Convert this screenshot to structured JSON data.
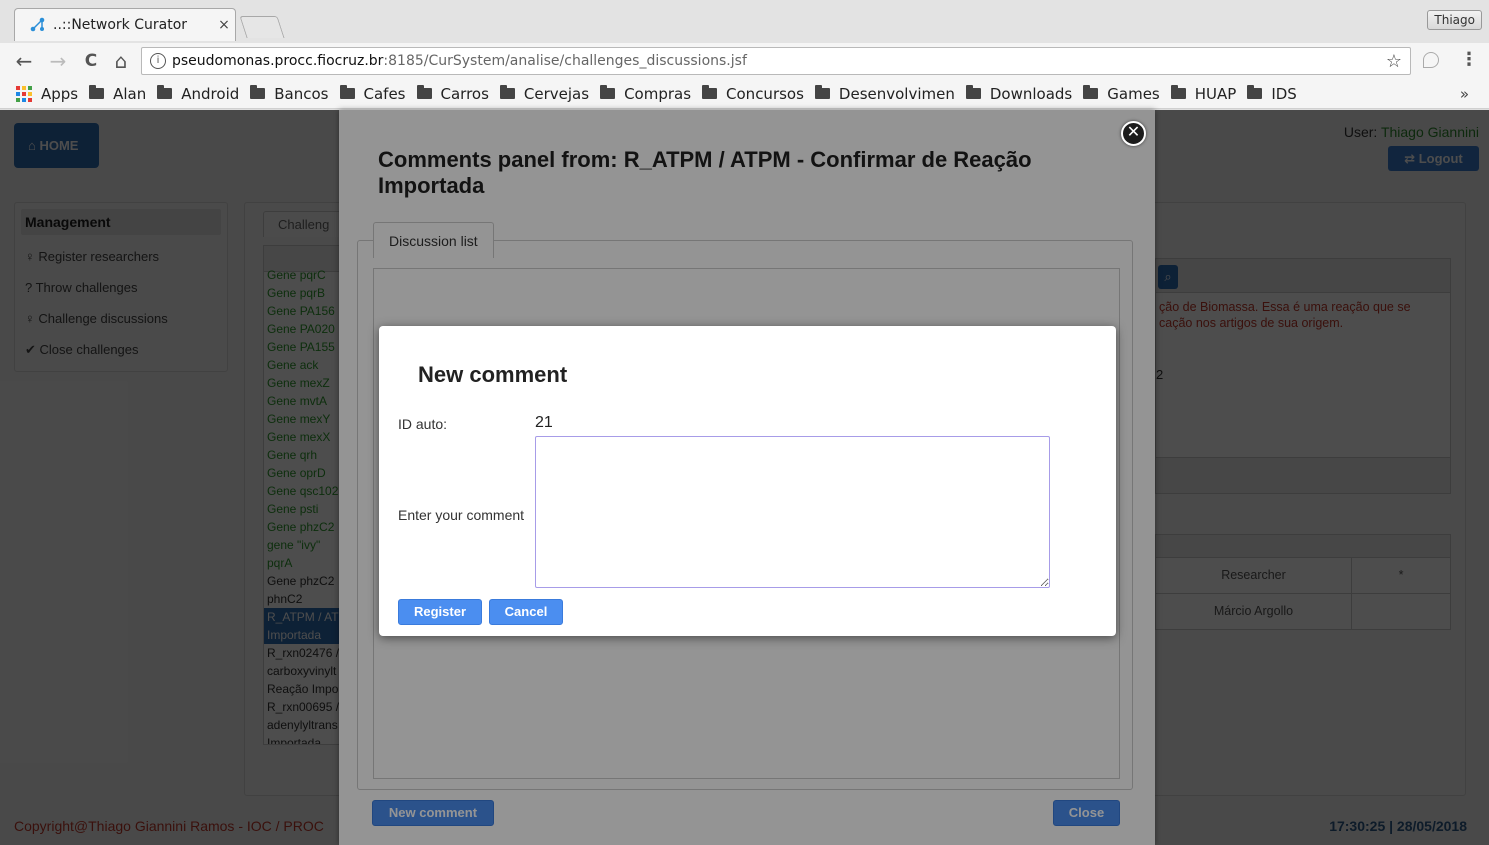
{
  "browser": {
    "tab_title": "..::Network Curator",
    "tab_close": "×",
    "profile_name": "Thiago",
    "url_host": "pseudomonas.procc.fiocruz.br",
    "url_rest": ":8185/CurSystem/analise/challenges_discussions.jsf",
    "back": "←",
    "forward": "→",
    "reload": "C",
    "home": "⌂",
    "star": "☆",
    "menu": "⋮",
    "bookmarks": [
      "Apps",
      "Alan",
      "Android",
      "Bancos",
      "Cafes",
      "Carros",
      "Cervejas",
      "Compras",
      "Concursos",
      "Desenvolvimen",
      "Downloads",
      "Games",
      "HUAP",
      "IDS"
    ],
    "bookmarks_more": "»"
  },
  "page": {
    "home_label": "⌂ HOME",
    "user_prefix": "User: ",
    "user_name": "Thiago Giannini",
    "logout_label": "⇄ Logout",
    "management_title": "Management",
    "management_items": [
      "♀ Register researchers",
      "? Throw challenges",
      "♀ Challenge discussions",
      "✔ Close challenges"
    ],
    "challenges_tab": "Challeng",
    "challenge_items": [
      "Gene pqrC",
      "Gene pqrB",
      "Gene PA156",
      "Gene PA020",
      "Gene PA155",
      "Gene ack",
      "Gene mexZ",
      "Gene mvtA",
      "Gene mexY",
      "Gene mexX",
      "Gene qrh",
      "Gene oprD",
      "Gene qsc102",
      "Gene psti",
      "Gene phzC2",
      "gene \"ivy\"",
      "pqrA",
      "Gene phzC2",
      "phnC2",
      "R_ATPM / AT",
      "Importada",
      "R_rxn02476 /",
      "carboxyvinylt",
      "Reação Impo",
      "R_rxn00695 /",
      "adenylyltrans",
      "Importada"
    ],
    "right_desc": "ção de Biomassa. Essa é uma reação que se cação nos artigos de sua origem.",
    "right_num": "2",
    "researcher_header": "Researcher",
    "researcher_star_header": "*",
    "researcher_name": "Márcio Argollo",
    "footer_left": "Copyright@Thiago Giannini Ramos - IOC / PROC",
    "footer_right": "17:30:25 | 28/05/2018"
  },
  "comments_panel": {
    "title": "Comments panel from: R_ATPM / ATPM - Confirmar de Reação Importada",
    "close_icon": "✕",
    "discussion_tab": "Discussion list",
    "new_comment_button": "New comment",
    "close_button": "Close"
  },
  "new_comment_modal": {
    "title": "New comment",
    "id_label": "ID auto:",
    "id_value": "21",
    "comment_label": "Enter your comment",
    "comment_value": "",
    "register_button": "Register",
    "cancel_button": "Cancel"
  }
}
